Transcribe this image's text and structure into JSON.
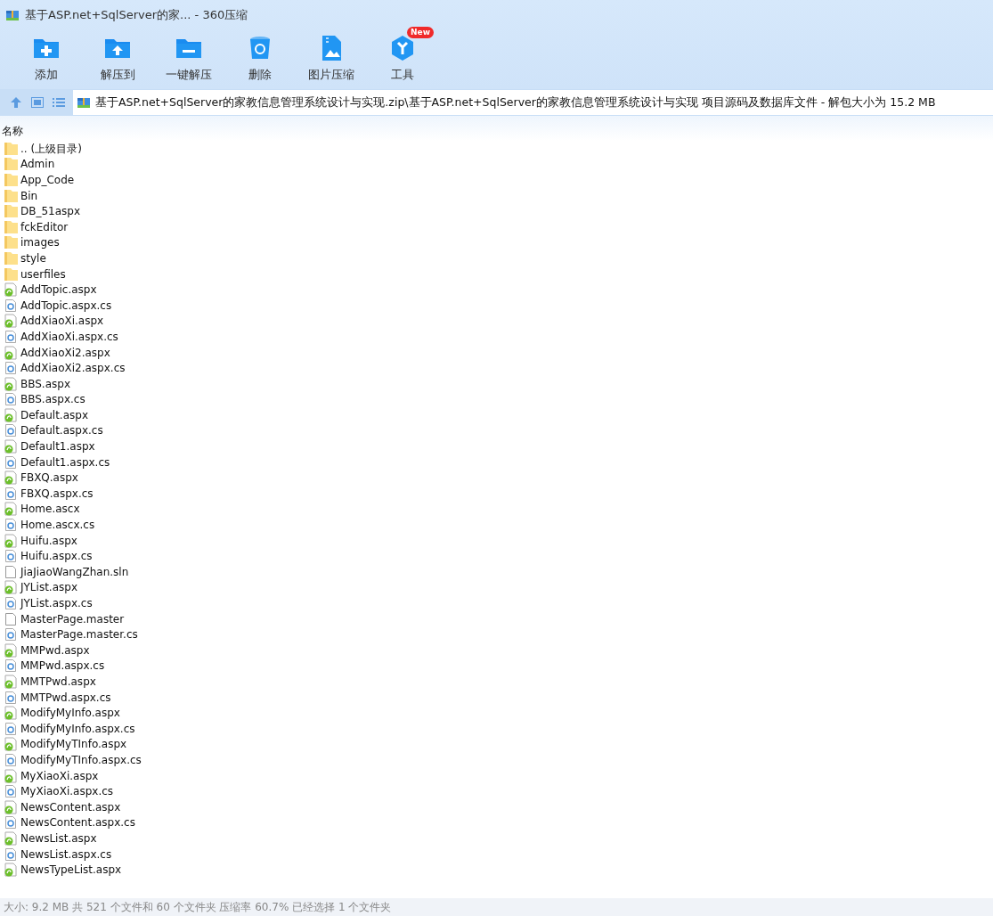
{
  "window": {
    "title": "基于ASP.net+SqlServer的家... - 360压缩"
  },
  "toolbar": [
    {
      "label": "添加",
      "kind": "add"
    },
    {
      "label": "解压到",
      "kind": "extract-to"
    },
    {
      "label": "一键解压",
      "kind": "extract"
    },
    {
      "label": "删除",
      "kind": "delete"
    },
    {
      "label": "图片压缩",
      "kind": "image"
    },
    {
      "label": "工具",
      "kind": "tools",
      "badge": "New"
    }
  ],
  "address_bar": {
    "path": "基于ASP.net+SqlServer的家教信息管理系统设计与实现.zip\\基于ASP.net+SqlServer的家教信息管理系统设计与实现 项目源码及数据库文件 - 解包大小为 15.2 MB"
  },
  "file_list": {
    "columns": [
      "名称"
    ],
    "rows": [
      {
        "name": ".. (上级目录)",
        "kind": "folder"
      },
      {
        "name": "Admin",
        "kind": "folder"
      },
      {
        "name": "App_Code",
        "kind": "folder"
      },
      {
        "name": "Bin",
        "kind": "folder"
      },
      {
        "name": "DB_51aspx",
        "kind": "folder"
      },
      {
        "name": "fckEditor",
        "kind": "folder"
      },
      {
        "name": "images",
        "kind": "folder"
      },
      {
        "name": "style",
        "kind": "folder"
      },
      {
        "name": "userfiles",
        "kind": "folder"
      },
      {
        "name": "AddTopic.aspx",
        "kind": "aspx"
      },
      {
        "name": "AddTopic.aspx.cs",
        "kind": "cs"
      },
      {
        "name": "AddXiaoXi.aspx",
        "kind": "aspx"
      },
      {
        "name": "AddXiaoXi.aspx.cs",
        "kind": "cs"
      },
      {
        "name": "AddXiaoXi2.aspx",
        "kind": "aspx"
      },
      {
        "name": "AddXiaoXi2.aspx.cs",
        "kind": "cs"
      },
      {
        "name": "BBS.aspx",
        "kind": "aspx"
      },
      {
        "name": "BBS.aspx.cs",
        "kind": "cs"
      },
      {
        "name": "Default.aspx",
        "kind": "aspx"
      },
      {
        "name": "Default.aspx.cs",
        "kind": "cs"
      },
      {
        "name": "Default1.aspx",
        "kind": "aspx"
      },
      {
        "name": "Default1.aspx.cs",
        "kind": "cs"
      },
      {
        "name": "FBXQ.aspx",
        "kind": "aspx"
      },
      {
        "name": "FBXQ.aspx.cs",
        "kind": "cs"
      },
      {
        "name": "Home.ascx",
        "kind": "aspx"
      },
      {
        "name": "Home.ascx.cs",
        "kind": "cs"
      },
      {
        "name": "Huifu.aspx",
        "kind": "aspx"
      },
      {
        "name": "Huifu.aspx.cs",
        "kind": "cs"
      },
      {
        "name": "JiaJiaoWangZhan.sln",
        "kind": "file"
      },
      {
        "name": "JYList.aspx",
        "kind": "aspx"
      },
      {
        "name": "JYList.aspx.cs",
        "kind": "cs"
      },
      {
        "name": "MasterPage.master",
        "kind": "file"
      },
      {
        "name": "MasterPage.master.cs",
        "kind": "cs"
      },
      {
        "name": "MMPwd.aspx",
        "kind": "aspx"
      },
      {
        "name": "MMPwd.aspx.cs",
        "kind": "cs"
      },
      {
        "name": "MMTPwd.aspx",
        "kind": "aspx"
      },
      {
        "name": "MMTPwd.aspx.cs",
        "kind": "cs"
      },
      {
        "name": "ModifyMyInfo.aspx",
        "kind": "aspx"
      },
      {
        "name": "ModifyMyInfo.aspx.cs",
        "kind": "cs"
      },
      {
        "name": "ModifyMyTInfo.aspx",
        "kind": "aspx"
      },
      {
        "name": "ModifyMyTInfo.aspx.cs",
        "kind": "cs"
      },
      {
        "name": "MyXiaoXi.aspx",
        "kind": "aspx"
      },
      {
        "name": "MyXiaoXi.aspx.cs",
        "kind": "cs"
      },
      {
        "name": "NewsContent.aspx",
        "kind": "aspx"
      },
      {
        "name": "NewsContent.aspx.cs",
        "kind": "cs"
      },
      {
        "name": "NewsList.aspx",
        "kind": "aspx"
      },
      {
        "name": "NewsList.aspx.cs",
        "kind": "cs"
      },
      {
        "name": "NewsTypeList.aspx",
        "kind": "aspx"
      }
    ]
  },
  "status_bar": {
    "text": "大小: 9.2 MB 共 521 个文件和 60 个文件夹 压缩率 60.7% 已经选择 1 个文件夹"
  }
}
